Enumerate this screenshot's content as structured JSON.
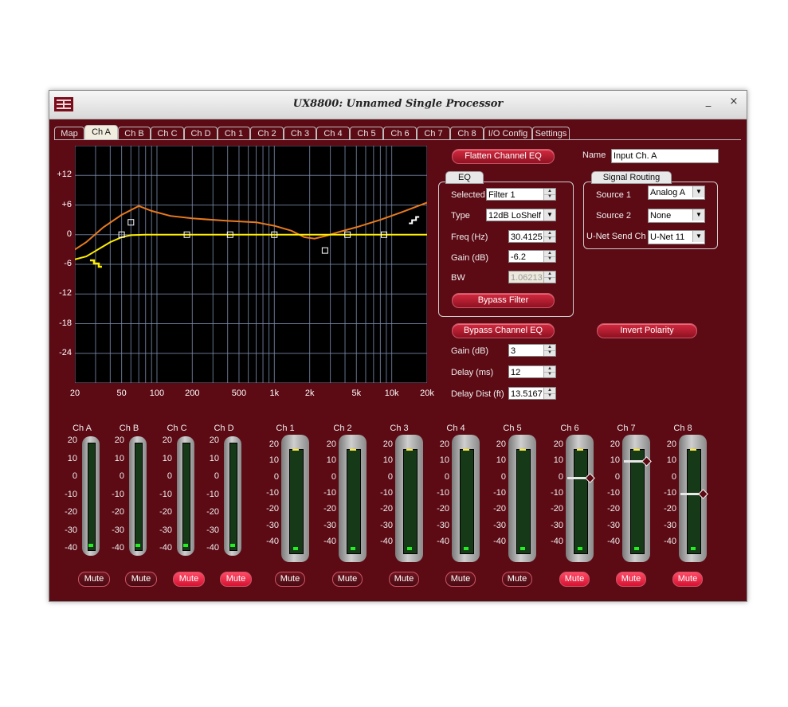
{
  "window": {
    "title": "UX8800: Unnamed Single Processor",
    "minimize": "_",
    "close": "×"
  },
  "tabs": [
    {
      "label": "Map",
      "active": false
    },
    {
      "label": "Ch A",
      "active": true
    },
    {
      "label": "Ch B",
      "active": false
    },
    {
      "label": "Ch C",
      "active": false
    },
    {
      "label": "Ch D",
      "active": false
    },
    {
      "label": "Ch 1",
      "active": false
    },
    {
      "label": "Ch 2",
      "active": false
    },
    {
      "label": "Ch 3",
      "active": false
    },
    {
      "label": "Ch 4",
      "active": false
    },
    {
      "label": "Ch 5",
      "active": false
    },
    {
      "label": "Ch 6",
      "active": false
    },
    {
      "label": "Ch 7",
      "active": false
    },
    {
      "label": "Ch 8",
      "active": false
    },
    {
      "label": "I/O Config",
      "active": false
    },
    {
      "label": "Settings",
      "active": false
    }
  ],
  "graph": {
    "y_labels": [
      "+12",
      "+6",
      "0",
      "-6",
      "-12",
      "-18",
      "-24"
    ],
    "x_labels": [
      "20",
      "50",
      "100",
      "200",
      "500",
      "1k",
      "2k",
      "5k",
      "10k",
      "20k"
    ],
    "colors": {
      "combined": "#e87a1e",
      "filter": "#ffee00",
      "grid": "#7f8fb0",
      "handle": "#ffffff"
    }
  },
  "eq": {
    "flatten_label": "Flatten Channel EQ",
    "group_label": "EQ",
    "selected_label": "Selected",
    "selected_value": "Filter 1",
    "type_label": "Type",
    "type_value": "12dB LoShelf",
    "freq_label": "Freq (Hz)",
    "freq_value": "30.4125",
    "gain_label": "Gain (dB)",
    "gain_value": "-6.2",
    "bw_label": "BW",
    "bw_value": "1.06213",
    "bypass_filter_label": "Bypass Filter",
    "bypass_channel_label": "Bypass Channel EQ",
    "channel_gain_label": "Gain (dB)",
    "channel_gain_value": "3",
    "delay_label": "Delay (ms)",
    "delay_value": "12",
    "delay_dist_label": "Delay Dist (ft)",
    "delay_dist_value": "13.5167"
  },
  "name": {
    "label": "Name",
    "value": "Input Ch. A"
  },
  "routing": {
    "group_label": "Signal Routing",
    "source1_label": "Source 1",
    "source1_value": "Analog A",
    "source2_label": "Source 2",
    "source2_value": "None",
    "unet_label": "U-Net Send Ch",
    "unet_value": "U-Net 11"
  },
  "invert_label": "Invert Polarity",
  "strips": [
    {
      "name": "Ch A",
      "muted": false
    },
    {
      "name": "Ch B",
      "muted": false
    },
    {
      "name": "Ch C",
      "muted": true
    },
    {
      "name": "Ch D",
      "muted": true
    },
    {
      "name": "Ch 1",
      "muted": false
    },
    {
      "name": "Ch 2",
      "muted": false
    },
    {
      "name": "Ch 3",
      "muted": false
    },
    {
      "name": "Ch 4",
      "muted": false
    },
    {
      "name": "Ch 5",
      "muted": false
    },
    {
      "name": "Ch 6",
      "muted": true,
      "fader_db": 0
    },
    {
      "name": "Ch 7",
      "muted": true,
      "fader_db": 10
    },
    {
      "name": "Ch 8",
      "muted": true,
      "fader_db": -10
    }
  ],
  "meter_scale": [
    "20",
    "10",
    "0",
    "-10",
    "-20",
    "-30",
    "-40"
  ],
  "mute_label": "Mute"
}
